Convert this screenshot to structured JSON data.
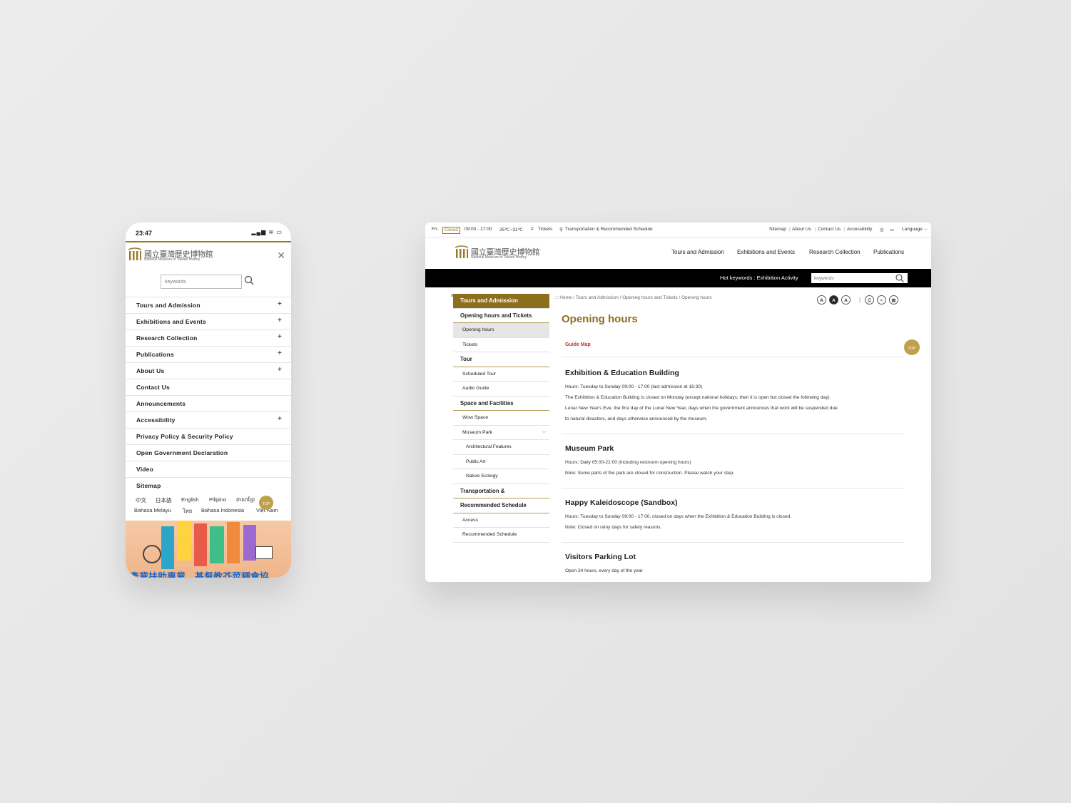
{
  "phone": {
    "time": "23:47",
    "status_icons": "▂▄▆ ≋ ▭",
    "logo_cn": "國立臺灣歷史博物館",
    "logo_en": "National Museum of Taiwan History",
    "search_placeholder": "keywords",
    "menu": [
      {
        "label": "Tours and Admission",
        "plus": "+"
      },
      {
        "label": "Exhibitions and Events",
        "plus": "+"
      },
      {
        "label": "Research Collection",
        "plus": "+"
      },
      {
        "label": "Publications",
        "plus": "+"
      },
      {
        "label": "About Us",
        "plus": "+"
      },
      {
        "label": "Contact Us",
        "plus": ""
      },
      {
        "label": "Announcements",
        "plus": ""
      },
      {
        "label": "Accessibility",
        "plus": "+"
      },
      {
        "label": "Privacy Policy & Security Policy",
        "plus": ""
      },
      {
        "label": "Open Government Declaration",
        "plus": ""
      },
      {
        "label": "Video",
        "plus": ""
      },
      {
        "label": "Sitemap",
        "plus": ""
      }
    ],
    "languages_row1": [
      "中文",
      "日本語",
      "English",
      "Pilipino",
      "ភាសាខ្មែរ"
    ],
    "languages_row2": [
      "Bahasa Melayu",
      "ไทย",
      "Bahasa Indonesia",
      "Việt Nam"
    ],
    "top_label": "TOP",
    "banner_text": "產業扶助專業、基督教芥菜種會協"
  },
  "desktop": {
    "top": {
      "day": "Fri.",
      "closed": "Closed",
      "hours": "09:00 - 17:00",
      "temp": "25℃~31℃",
      "tickets": "Tickets",
      "transport": "Transportation & Recommended Schedule",
      "links": [
        "Sitemap",
        "About Us",
        "Contact Us",
        "Accessibility"
      ],
      "language": "Language"
    },
    "logo_cn": "國立臺灣歷史博物館",
    "logo_en": "National Museum of Taiwan History",
    "nav": [
      "Tours and Admission",
      "Exhibitions and Events",
      "Research Collection",
      "Publications"
    ],
    "hot": "Hot keywords : Exhibition Activity",
    "search_placeholder": "keywords",
    "sidebar": [
      {
        "label": "Tours and Admission",
        "kind": "head"
      },
      {
        "label": "Opening hours and Tickets",
        "kind": "sec"
      },
      {
        "label": "Opening hours",
        "kind": "sub active"
      },
      {
        "label": "Tickets",
        "kind": "sub"
      },
      {
        "label": "Tour",
        "kind": "sec"
      },
      {
        "label": "Scheduled Tour",
        "kind": "sub"
      },
      {
        "label": "Audio Guide",
        "kind": "sub"
      },
      {
        "label": "Space and Facilities",
        "kind": "sec"
      },
      {
        "label": "Wow Space",
        "kind": "sub"
      },
      {
        "label": "Museum Park",
        "kind": "sub",
        "chevron": "⌵"
      },
      {
        "label": "Architectural Features",
        "kind": "sub2"
      },
      {
        "label": "Public Art",
        "kind": "sub2"
      },
      {
        "label": "Nature Ecology",
        "kind": "sub2"
      },
      {
        "label": "Transportation &",
        "kind": "sec"
      },
      {
        "label": "Recommended Schedule",
        "kind": "sec"
      },
      {
        "label": "Access",
        "kind": "sub"
      },
      {
        "label": "Recommended Schedule",
        "kind": "sub"
      }
    ],
    "breadcrumb": ":::  Home  /  Tours and Admission  /  Opening hours and Tickets  /  Opening hours",
    "font_tools": [
      "A",
      "A",
      "A"
    ],
    "title": "Opening hours",
    "guide_map": "Guide Map",
    "top_label": "TOP",
    "sections": [
      {
        "heading": "Exhibition & Education Building",
        "lines": [
          "Hours: Tuesday to Sunday 09:00 - 17:00 (last admission at 16:30)",
          "The Exhibition & Education Building is closed on Monday (except national holidays; then it is open but closed the following day).",
          "Lunar New Year's Eve, the first day of the Lunar New Year, days when the government announces that work will be suspended due",
          "to natural disasters, and days otherwise announced by the museum."
        ]
      },
      {
        "heading": "Museum Park",
        "lines": [
          "Hours: Daily 05:00-22:00 (including restroom opening hours)",
          "Note: Some parts of the park are closed for construction. Please watch your step."
        ]
      },
      {
        "heading": "Happy Kaleidoscope (Sandbox)",
        "lines": [
          "Hours: Tuesday to Sunday 09:00 - 17:00, closed on days when the Exhibition & Education Building is closed.",
          "Note: Closed on rainy days for safety reasons."
        ]
      },
      {
        "heading": "Visitors Parking Lot",
        "lines": [
          "Open 24 hours, every day of the year"
        ]
      }
    ]
  }
}
